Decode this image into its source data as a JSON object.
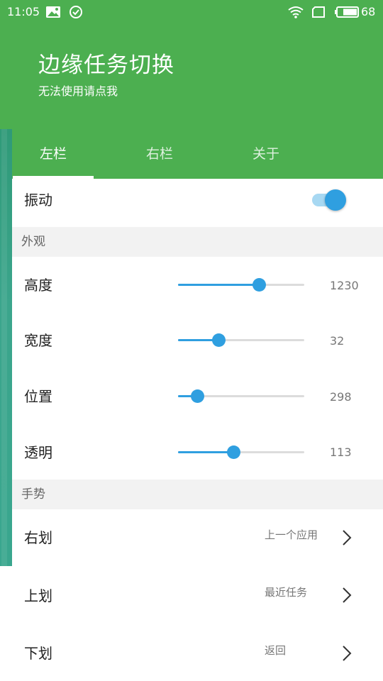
{
  "status_bar": {
    "time": "11:05",
    "battery": "68",
    "icons": [
      "image-icon",
      "check-circle-icon",
      "wifi-icon",
      "sim-icon",
      "battery-icon"
    ]
  },
  "header": {
    "title": "边缘任务切换",
    "subtitle": "无法使用请点我"
  },
  "tabs": [
    {
      "label": "左栏",
      "active": true
    },
    {
      "label": "右栏",
      "active": false
    },
    {
      "label": "关于",
      "active": false
    }
  ],
  "vibration": {
    "label": "振动",
    "enabled": true
  },
  "appearance": {
    "header": "外观",
    "sliders": [
      {
        "label": "高度",
        "value": "1230",
        "fraction": 0.64
      },
      {
        "label": "宽度",
        "value": "32",
        "fraction": 0.32
      },
      {
        "label": "位置",
        "value": "298",
        "fraction": 0.15
      },
      {
        "label": "透明",
        "value": "113",
        "fraction": 0.44
      }
    ]
  },
  "gestures": {
    "header": "手势",
    "items": [
      {
        "label": "右划",
        "value": "上一个应用"
      },
      {
        "label": "上划",
        "value": "最近任务"
      },
      {
        "label": "下划",
        "value": "返回"
      }
    ]
  },
  "colors": {
    "primary": "#4caf50",
    "accent": "#2f9fe0",
    "edge_strip": "#3ba58c"
  }
}
